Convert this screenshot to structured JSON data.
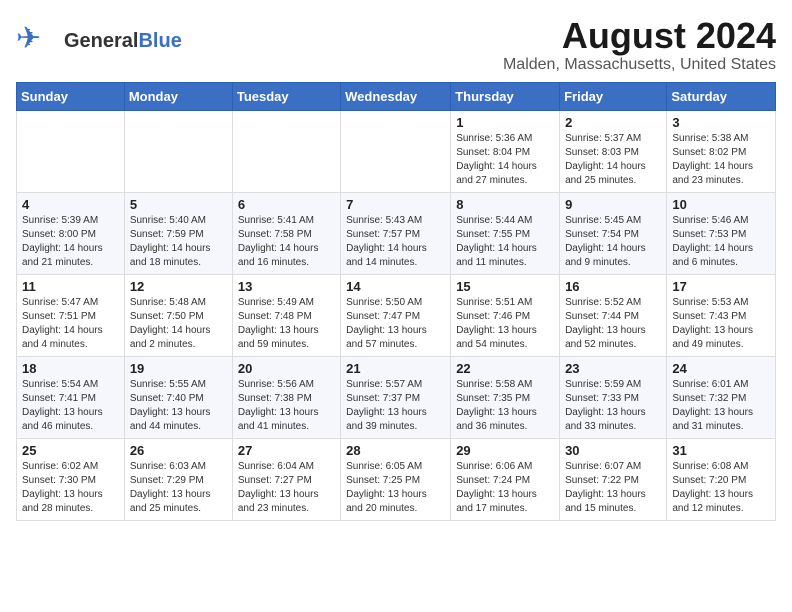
{
  "header": {
    "logo_general": "General",
    "logo_blue": "Blue",
    "month_title": "August 2024",
    "location": "Malden, Massachusetts, United States"
  },
  "weekdays": [
    "Sunday",
    "Monday",
    "Tuesday",
    "Wednesday",
    "Thursday",
    "Friday",
    "Saturday"
  ],
  "weeks": [
    [
      {
        "day": "",
        "info": ""
      },
      {
        "day": "",
        "info": ""
      },
      {
        "day": "",
        "info": ""
      },
      {
        "day": "",
        "info": ""
      },
      {
        "day": "1",
        "info": "Sunrise: 5:36 AM\nSunset: 8:04 PM\nDaylight: 14 hours\nand 27 minutes."
      },
      {
        "day": "2",
        "info": "Sunrise: 5:37 AM\nSunset: 8:03 PM\nDaylight: 14 hours\nand 25 minutes."
      },
      {
        "day": "3",
        "info": "Sunrise: 5:38 AM\nSunset: 8:02 PM\nDaylight: 14 hours\nand 23 minutes."
      }
    ],
    [
      {
        "day": "4",
        "info": "Sunrise: 5:39 AM\nSunset: 8:00 PM\nDaylight: 14 hours\nand 21 minutes."
      },
      {
        "day": "5",
        "info": "Sunrise: 5:40 AM\nSunset: 7:59 PM\nDaylight: 14 hours\nand 18 minutes."
      },
      {
        "day": "6",
        "info": "Sunrise: 5:41 AM\nSunset: 7:58 PM\nDaylight: 14 hours\nand 16 minutes."
      },
      {
        "day": "7",
        "info": "Sunrise: 5:43 AM\nSunset: 7:57 PM\nDaylight: 14 hours\nand 14 minutes."
      },
      {
        "day": "8",
        "info": "Sunrise: 5:44 AM\nSunset: 7:55 PM\nDaylight: 14 hours\nand 11 minutes."
      },
      {
        "day": "9",
        "info": "Sunrise: 5:45 AM\nSunset: 7:54 PM\nDaylight: 14 hours\nand 9 minutes."
      },
      {
        "day": "10",
        "info": "Sunrise: 5:46 AM\nSunset: 7:53 PM\nDaylight: 14 hours\nand 6 minutes."
      }
    ],
    [
      {
        "day": "11",
        "info": "Sunrise: 5:47 AM\nSunset: 7:51 PM\nDaylight: 14 hours\nand 4 minutes."
      },
      {
        "day": "12",
        "info": "Sunrise: 5:48 AM\nSunset: 7:50 PM\nDaylight: 14 hours\nand 2 minutes."
      },
      {
        "day": "13",
        "info": "Sunrise: 5:49 AM\nSunset: 7:48 PM\nDaylight: 13 hours\nand 59 minutes."
      },
      {
        "day": "14",
        "info": "Sunrise: 5:50 AM\nSunset: 7:47 PM\nDaylight: 13 hours\nand 57 minutes."
      },
      {
        "day": "15",
        "info": "Sunrise: 5:51 AM\nSunset: 7:46 PM\nDaylight: 13 hours\nand 54 minutes."
      },
      {
        "day": "16",
        "info": "Sunrise: 5:52 AM\nSunset: 7:44 PM\nDaylight: 13 hours\nand 52 minutes."
      },
      {
        "day": "17",
        "info": "Sunrise: 5:53 AM\nSunset: 7:43 PM\nDaylight: 13 hours\nand 49 minutes."
      }
    ],
    [
      {
        "day": "18",
        "info": "Sunrise: 5:54 AM\nSunset: 7:41 PM\nDaylight: 13 hours\nand 46 minutes."
      },
      {
        "day": "19",
        "info": "Sunrise: 5:55 AM\nSunset: 7:40 PM\nDaylight: 13 hours\nand 44 minutes."
      },
      {
        "day": "20",
        "info": "Sunrise: 5:56 AM\nSunset: 7:38 PM\nDaylight: 13 hours\nand 41 minutes."
      },
      {
        "day": "21",
        "info": "Sunrise: 5:57 AM\nSunset: 7:37 PM\nDaylight: 13 hours\nand 39 minutes."
      },
      {
        "day": "22",
        "info": "Sunrise: 5:58 AM\nSunset: 7:35 PM\nDaylight: 13 hours\nand 36 minutes."
      },
      {
        "day": "23",
        "info": "Sunrise: 5:59 AM\nSunset: 7:33 PM\nDaylight: 13 hours\nand 33 minutes."
      },
      {
        "day": "24",
        "info": "Sunrise: 6:01 AM\nSunset: 7:32 PM\nDaylight: 13 hours\nand 31 minutes."
      }
    ],
    [
      {
        "day": "25",
        "info": "Sunrise: 6:02 AM\nSunset: 7:30 PM\nDaylight: 13 hours\nand 28 minutes."
      },
      {
        "day": "26",
        "info": "Sunrise: 6:03 AM\nSunset: 7:29 PM\nDaylight: 13 hours\nand 25 minutes."
      },
      {
        "day": "27",
        "info": "Sunrise: 6:04 AM\nSunset: 7:27 PM\nDaylight: 13 hours\nand 23 minutes."
      },
      {
        "day": "28",
        "info": "Sunrise: 6:05 AM\nSunset: 7:25 PM\nDaylight: 13 hours\nand 20 minutes."
      },
      {
        "day": "29",
        "info": "Sunrise: 6:06 AM\nSunset: 7:24 PM\nDaylight: 13 hours\nand 17 minutes."
      },
      {
        "day": "30",
        "info": "Sunrise: 6:07 AM\nSunset: 7:22 PM\nDaylight: 13 hours\nand 15 minutes."
      },
      {
        "day": "31",
        "info": "Sunrise: 6:08 AM\nSunset: 7:20 PM\nDaylight: 13 hours\nand 12 minutes."
      }
    ]
  ]
}
